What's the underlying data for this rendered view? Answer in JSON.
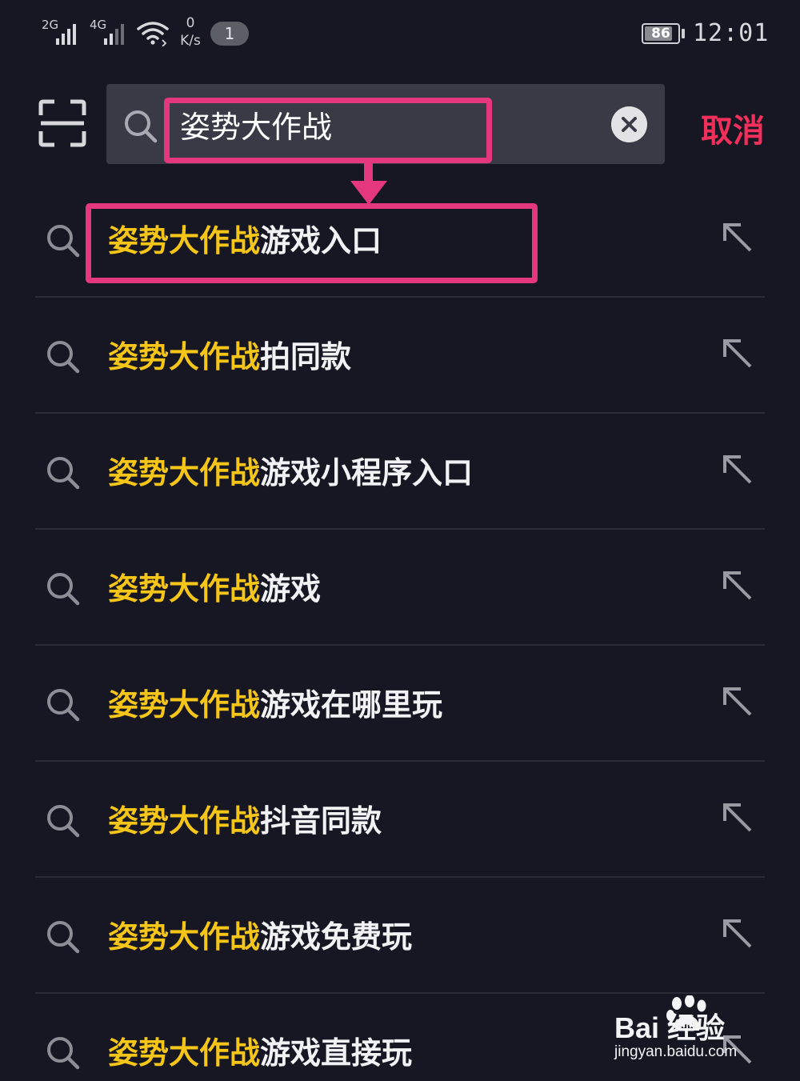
{
  "status_bar": {
    "network_1": "2G",
    "network_2": "4G",
    "speed_value": "0",
    "speed_unit": "K/s",
    "notification_count": "1",
    "battery": "86",
    "battery_level": 0.86,
    "time": "12:01"
  },
  "search": {
    "query": "姿势大作战",
    "cancel_label": "取消"
  },
  "icons": {
    "scan": "scan-icon",
    "search": "search-icon",
    "clear": "clear-icon",
    "fill_suggestion": "arrow-up-left-icon"
  },
  "colors": {
    "background": "#161722",
    "search_box": "#393a45",
    "match_highlight": "#f5c518",
    "cancel": "#f0305a",
    "annotation": "#e5377e"
  },
  "suggestions": [
    {
      "match": "姿势大作战",
      "rest": "游戏入口"
    },
    {
      "match": "姿势大作战",
      "rest": "拍同款"
    },
    {
      "match": "姿势大作战",
      "rest": "游戏小程序入口"
    },
    {
      "match": "姿势大作战",
      "rest": "游戏"
    },
    {
      "match": "姿势大作战",
      "rest": "游戏在哪里玩"
    },
    {
      "match": "姿势大作战",
      "rest": "抖音同款"
    },
    {
      "match": "姿势大作战",
      "rest": "游戏免费玩"
    },
    {
      "match": "姿势大作战",
      "rest": "游戏直接玩"
    }
  ],
  "watermark": {
    "logo": "Bai 经验",
    "url": "jingyan.baidu.com"
  }
}
